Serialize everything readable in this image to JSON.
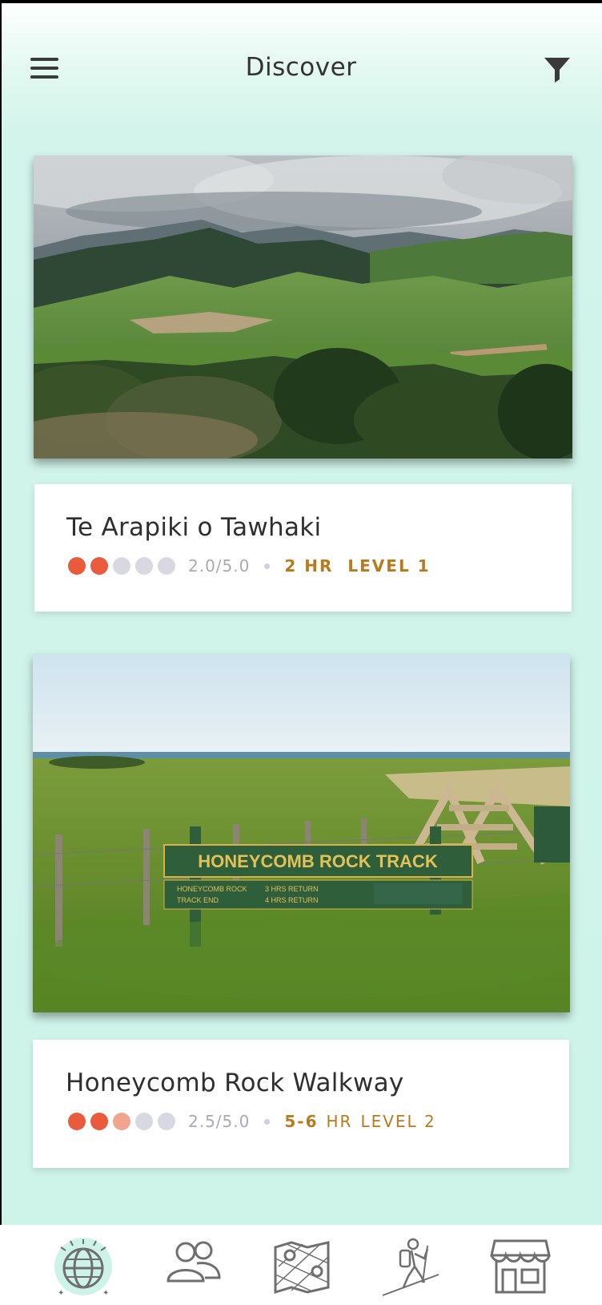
{
  "header": {
    "title": "Discover",
    "menu_icon": "hamburger-menu-icon",
    "filter_icon": "filter-funnel-icon"
  },
  "colors": {
    "accent_orange": "#ea5a3d",
    "accent_gold": "#b87a1c",
    "background_mint": "#cdf3e8"
  },
  "trails": [
    {
      "name": "Te Arapiki o Tawhaki",
      "rating_text": "2.0/5.0",
      "rating_value": 2.0,
      "duration": "2 HR",
      "level": "LEVEL 1",
      "image": "green hills and mountains landscape"
    },
    {
      "name": "Honeycomb Rock Walkway",
      "rating_text": "2.5/5.0",
      "rating_value": 2.5,
      "duration": "5-6",
      "duration_suffix": "HR",
      "level": "LEVEL 2",
      "image": "Honeycomb Rock Track sign in coastal field",
      "sign": {
        "title": "HONEYCOMB ROCK TRACK",
        "line1_left": "HONEYCOMB ROCK",
        "line1_right": "3 HRS RETURN",
        "line2_left": "TRACK END",
        "line2_right": "4 HRS RETURN"
      }
    }
  ],
  "bottom_nav": [
    {
      "name": "discover",
      "icon": "globe-icon",
      "active": true
    },
    {
      "name": "community",
      "icon": "people-icon",
      "active": false
    },
    {
      "name": "map",
      "icon": "map-icon",
      "active": false
    },
    {
      "name": "hiking",
      "icon": "hiker-icon",
      "active": false
    },
    {
      "name": "store",
      "icon": "shop-icon",
      "active": false
    }
  ]
}
